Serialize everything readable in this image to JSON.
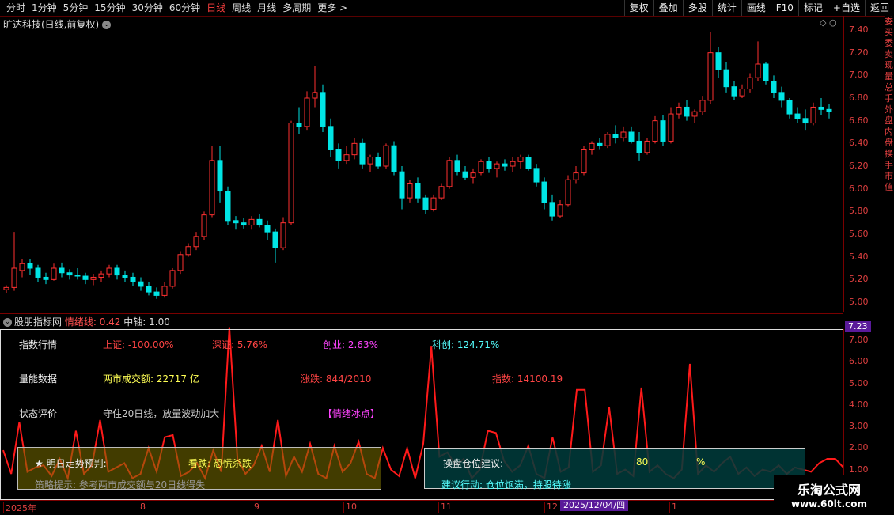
{
  "toolbar": {
    "periods": [
      "分时",
      "1分钟",
      "5分钟",
      "15分钟",
      "30分钟",
      "60分钟",
      "日线",
      "周线",
      "月线",
      "多周期",
      "更多 >"
    ],
    "active_index": 6,
    "right_buttons": [
      "复权",
      "叠加",
      "多股",
      "统计",
      "画线",
      "F10",
      "标记",
      "+自选",
      "返回"
    ]
  },
  "stock_title": "旷达科技(日线,前复权)",
  "price_axis": [
    "7.40",
    "7.20",
    "7.00",
    "6.80",
    "6.60",
    "6.40",
    "6.20",
    "6.00",
    "5.80",
    "5.60",
    "5.40",
    "5.20",
    "5.00"
  ],
  "side_text": "委买委卖现量总手外盘内盘换手市值",
  "indicator": {
    "name": "股朋指标网",
    "mood_label": "情绪线:",
    "mood_value": "0.42",
    "axis_label": "中轴:",
    "axis_value": "1.00",
    "current_price": "7.23",
    "axis": [
      "7.00",
      "6.00",
      "5.00",
      "4.00",
      "3.00",
      "2.00",
      "1.00"
    ]
  },
  "info": {
    "index_title": "指数行情",
    "sh": "上证: -100.00%",
    "sz": "深证: 5.76%",
    "cy": "创业: 2.63%",
    "kc": "科创: 124.71%",
    "volume_title": "量能数据",
    "turnover": "两市成交额: 22717 亿",
    "updown": "涨跌: 844/2010",
    "index_val": "指数: 14100.19",
    "status_title": "状态评价",
    "status_text": "守住20日线，放量波动加大",
    "mood_tag": "【情绪冰点】"
  },
  "prediction": {
    "title": "★ 明日走势预判:",
    "forecast": "看跌: 恐慌杀跌",
    "tip": "策略提示: 参考两市成交额与20日线得失"
  },
  "position": {
    "title": "操盘仓位建议:",
    "value": "80",
    "unit": "%",
    "action": "建议行动: 仓位饱满，持股待涨"
  },
  "dates": [
    "2025年",
    "8",
    "9",
    "10",
    "11",
    "12",
    "1"
  ],
  "date_highlight": "2025/12/04/四",
  "watermark": {
    "line1": "乐淘公式网",
    "line2": "www.60lt.com"
  },
  "colors": {
    "up": "#ff3030",
    "down": "#00e5e5",
    "mood_line": "#ff1a1a"
  },
  "candles": [
    [
      5.11,
      5.15,
      5.08,
      5.13
    ],
    [
      5.13,
      5.62,
      5.1,
      5.3
    ],
    [
      5.28,
      5.38,
      5.22,
      5.34
    ],
    [
      5.34,
      5.38,
      5.24,
      5.3
    ],
    [
      5.3,
      5.33,
      5.18,
      5.22
    ],
    [
      5.22,
      5.26,
      5.16,
      5.2
    ],
    [
      5.2,
      5.34,
      5.19,
      5.3
    ],
    [
      5.3,
      5.35,
      5.22,
      5.26
    ],
    [
      5.26,
      5.29,
      5.2,
      5.24
    ],
    [
      5.24,
      5.3,
      5.2,
      5.23
    ],
    [
      5.23,
      5.26,
      5.16,
      5.2
    ],
    [
      5.2,
      5.25,
      5.15,
      5.22
    ],
    [
      5.22,
      5.28,
      5.18,
      5.25
    ],
    [
      5.25,
      5.33,
      5.22,
      5.3
    ],
    [
      5.3,
      5.33,
      5.2,
      5.24
    ],
    [
      5.24,
      5.28,
      5.18,
      5.22
    ],
    [
      5.22,
      5.26,
      5.14,
      5.18
    ],
    [
      5.18,
      5.22,
      5.1,
      5.14
    ],
    [
      5.14,
      5.18,
      5.06,
      5.09
    ],
    [
      5.09,
      5.13,
      5.03,
      5.06
    ],
    [
      5.06,
      5.18,
      5.04,
      5.14
    ],
    [
      5.14,
      5.3,
      5.12,
      5.28
    ],
    [
      5.28,
      5.45,
      5.25,
      5.42
    ],
    [
      5.42,
      5.52,
      5.4,
      5.49
    ],
    [
      5.49,
      5.62,
      5.46,
      5.58
    ],
    [
      5.58,
      5.8,
      5.55,
      5.77
    ],
    [
      5.77,
      6.38,
      5.75,
      6.25
    ],
    [
      6.25,
      6.38,
      5.88,
      5.98
    ],
    [
      5.98,
      6.02,
      5.68,
      5.72
    ],
    [
      5.72,
      5.76,
      5.64,
      5.7
    ],
    [
      5.7,
      5.74,
      5.65,
      5.68
    ],
    [
      5.68,
      5.76,
      5.64,
      5.73
    ],
    [
      5.73,
      5.78,
      5.66,
      5.68
    ],
    [
      5.68,
      5.72,
      5.55,
      5.62
    ],
    [
      5.62,
      5.65,
      5.35,
      5.48
    ],
    [
      5.48,
      5.75,
      5.46,
      5.7
    ],
    [
      5.7,
      6.6,
      5.68,
      6.58
    ],
    [
      6.58,
      6.72,
      6.48,
      6.55
    ],
    [
      6.55,
      6.86,
      6.52,
      6.8
    ],
    [
      6.8,
      7.08,
      6.72,
      6.85
    ],
    [
      6.85,
      6.92,
      6.5,
      6.55
    ],
    [
      6.55,
      6.62,
      6.28,
      6.35
    ],
    [
      6.35,
      6.4,
      6.18,
      6.25
    ],
    [
      6.25,
      6.38,
      6.22,
      6.3
    ],
    [
      6.3,
      6.45,
      6.26,
      6.4
    ],
    [
      6.4,
      6.44,
      6.18,
      6.22
    ],
    [
      6.22,
      6.3,
      6.15,
      6.28
    ],
    [
      6.28,
      6.32,
      6.18,
      6.2
    ],
    [
      6.2,
      6.4,
      6.18,
      6.38
    ],
    [
      6.38,
      6.42,
      6.12,
      6.15
    ],
    [
      6.15,
      6.2,
      5.82,
      5.92
    ],
    [
      5.92,
      6.08,
      5.88,
      6.05
    ],
    [
      6.05,
      6.1,
      5.88,
      5.92
    ],
    [
      5.92,
      5.95,
      5.78,
      5.82
    ],
    [
      5.82,
      5.95,
      5.8,
      5.92
    ],
    [
      5.92,
      6.05,
      5.9,
      6.02
    ],
    [
      6.02,
      6.28,
      6.0,
      6.25
    ],
    [
      6.25,
      6.3,
      6.12,
      6.15
    ],
    [
      6.15,
      6.2,
      6.08,
      6.1
    ],
    [
      6.1,
      6.18,
      6.05,
      6.14
    ],
    [
      6.14,
      6.26,
      6.12,
      6.24
    ],
    [
      6.24,
      6.28,
      6.14,
      6.18
    ],
    [
      6.18,
      6.24,
      6.1,
      6.22
    ],
    [
      6.22,
      6.26,
      6.16,
      6.2
    ],
    [
      6.2,
      6.28,
      6.15,
      6.24
    ],
    [
      6.24,
      6.3,
      6.18,
      6.28
    ],
    [
      6.28,
      6.3,
      6.16,
      6.18
    ],
    [
      6.18,
      6.22,
      6.02,
      6.06
    ],
    [
      6.06,
      6.1,
      5.82,
      5.88
    ],
    [
      5.88,
      5.95,
      5.72,
      5.76
    ],
    [
      5.76,
      5.9,
      5.74,
      5.86
    ],
    [
      5.86,
      6.12,
      5.84,
      6.08
    ],
    [
      6.08,
      6.2,
      6.05,
      6.14
    ],
    [
      6.14,
      6.38,
      6.12,
      6.35
    ],
    [
      6.35,
      6.42,
      6.3,
      6.4
    ],
    [
      6.4,
      6.45,
      6.35,
      6.38
    ],
    [
      6.38,
      6.5,
      6.36,
      6.48
    ],
    [
      6.48,
      6.56,
      6.4,
      6.45
    ],
    [
      6.45,
      6.55,
      6.42,
      6.5
    ],
    [
      6.5,
      6.55,
      6.4,
      6.42
    ],
    [
      6.42,
      6.5,
      6.25,
      6.32
    ],
    [
      6.32,
      6.45,
      6.3,
      6.42
    ],
    [
      6.42,
      6.64,
      6.4,
      6.6
    ],
    [
      6.6,
      6.65,
      6.38,
      6.42
    ],
    [
      6.42,
      6.72,
      6.4,
      6.66
    ],
    [
      6.66,
      6.76,
      6.62,
      6.72
    ],
    [
      6.72,
      6.78,
      6.6,
      6.64
    ],
    [
      6.64,
      6.7,
      6.58,
      6.68
    ],
    [
      6.68,
      6.82,
      6.65,
      6.78
    ],
    [
      6.78,
      7.38,
      6.75,
      7.2
    ],
    [
      7.2,
      7.25,
      6.98,
      7.05
    ],
    [
      7.05,
      7.12,
      6.85,
      6.9
    ],
    [
      6.9,
      6.95,
      6.78,
      6.82
    ],
    [
      6.82,
      6.92,
      6.8,
      6.88
    ],
    [
      6.88,
      7.02,
      6.85,
      6.98
    ],
    [
      6.98,
      7.3,
      6.95,
      7.1
    ],
    [
      7.1,
      7.12,
      6.92,
      6.95
    ],
    [
      6.95,
      7.0,
      6.8,
      6.85
    ],
    [
      6.85,
      6.9,
      6.72,
      6.78
    ],
    [
      6.78,
      6.8,
      6.62,
      6.66
    ],
    [
      6.66,
      6.72,
      6.58,
      6.62
    ],
    [
      6.62,
      6.7,
      6.52,
      6.58
    ],
    [
      6.58,
      6.76,
      6.56,
      6.72
    ],
    [
      6.72,
      6.8,
      6.65,
      6.7
    ],
    [
      6.7,
      6.75,
      6.62,
      6.68
    ]
  ],
  "mood": [
    1.9,
    0.8,
    3.2,
    0.9,
    1.1,
    1.2,
    0.7,
    1.5,
    0.6,
    2.8,
    0.8,
    1.2,
    3.3,
    0.9,
    1.1,
    1.3,
    0.6,
    0.8,
    2.0,
    0.9,
    2.5,
    2.6,
    0.7,
    0.9,
    1.3,
    0.6,
    1.9,
    0.9,
    7.6,
    1.5,
    0.8,
    1.2,
    2.1,
    0.9,
    3.3,
    0.7,
    1.6,
    0.9,
    2.2,
    0.8,
    0.6,
    2.1,
    0.9,
    1.3,
    2.3,
    0.8,
    0.6,
    2.0,
    1.0,
    0.7,
    2.0,
    0.6,
    2.2,
    6.7,
    1.6,
    1.8,
    1.2,
    1.5,
    0.6,
    1.0,
    2.8,
    2.7,
    1.4,
    0.9,
    1.2,
    2.1,
    0.8,
    0.6,
    2.5,
    0.9,
    1.1,
    4.7,
    4.7,
    0.9,
    1.2,
    3.9,
    0.8,
    1.0,
    0.7,
    4.8,
    0.9,
    1.2,
    0.8,
    0.6,
    1.0,
    5.9,
    0.8,
    1.2,
    0.9,
    1.3,
    1.6,
    0.8,
    1.1,
    0.7,
    1.0,
    0.9,
    1.2,
    0.8,
    1.1,
    1.0,
    0.9,
    1.3,
    1.5,
    1.5,
    1.1
  ]
}
